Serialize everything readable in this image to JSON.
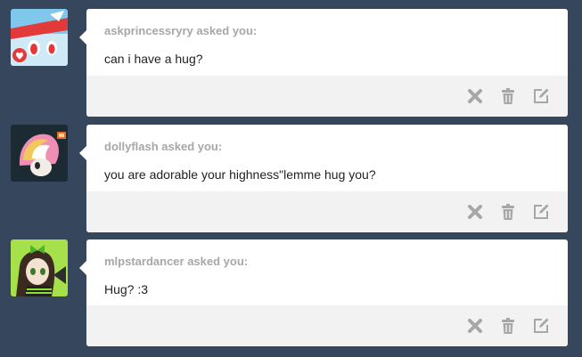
{
  "colors": {
    "dashboard_bg": "#36465d",
    "card_bg": "#ffffff",
    "footer_bg": "#f2f2f2",
    "asker_text": "#a7a7a7",
    "question_text": "#222222",
    "icon": "#a7a7a7"
  },
  "posts": [
    {
      "asker": "askprincessryry asked you:",
      "question": "can i have a hug?",
      "actions": [
        "close-icon",
        "trash-icon",
        "edit-icon"
      ]
    },
    {
      "asker": "dollyflash asked you:",
      "question": "you are adorable your highness\"lemme hug you?",
      "actions": [
        "close-icon",
        "trash-icon",
        "edit-icon"
      ]
    },
    {
      "asker": "mlpstardancer asked you:",
      "question": "Hug? :3",
      "actions": [
        "close-icon",
        "trash-icon",
        "edit-icon"
      ]
    }
  ]
}
